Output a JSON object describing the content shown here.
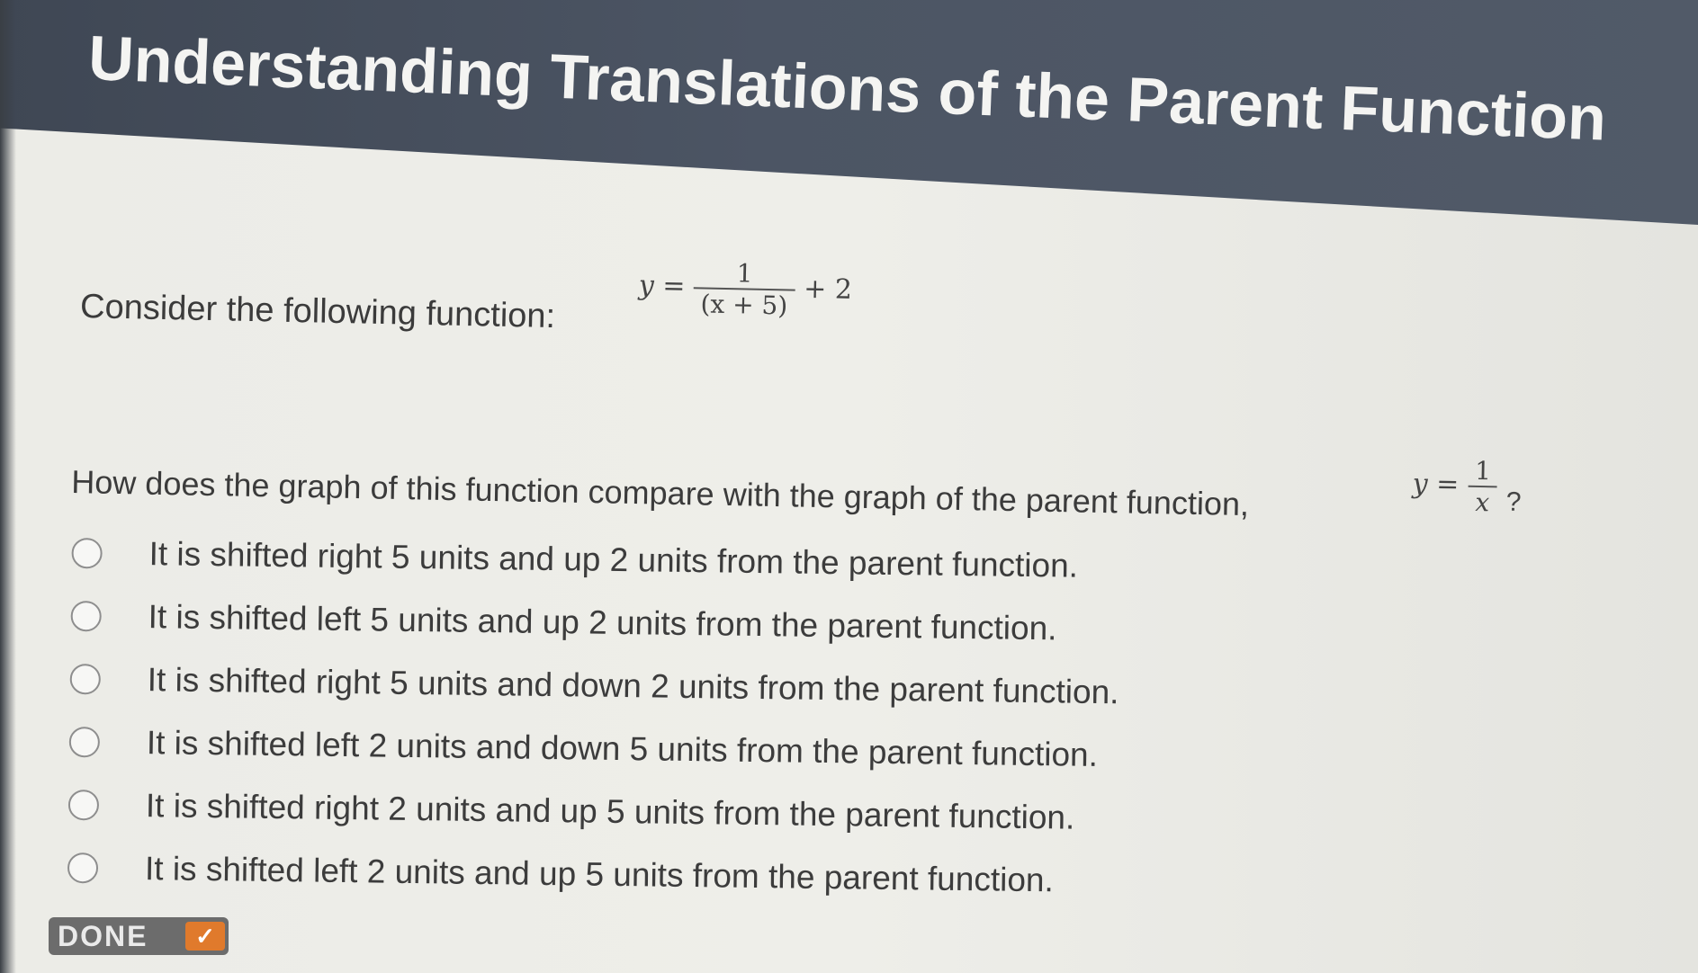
{
  "header": {
    "title": "Understanding Translations of the Parent Function"
  },
  "prompt": {
    "text": "Consider the following function:",
    "equation": {
      "lhs": "y",
      "eq": "=",
      "numerator": "1",
      "denominator": "(x + 5)",
      "tail": "+ 2"
    }
  },
  "question": {
    "text": "How does the graph of this function compare with the graph of the parent function,",
    "parent": {
      "lhs": "y",
      "eq": "=",
      "numerator": "1",
      "denominator": "x"
    },
    "end": "?"
  },
  "options": [
    "It is shifted right 5 units and up 2 units from the parent function.",
    "It is shifted left 5 units and up 2 units from the parent function.",
    "It is shifted right 5 units and down 2 units from the parent function.",
    "It is shifted left 2 units and down 5 units from the parent function.",
    "It is shifted right 2 units and up 5 units from the parent function.",
    "It is shifted left 2 units and up 5 units from the parent function."
  ],
  "done_button": {
    "label": "DONE",
    "icon": "checkmark-icon"
  },
  "colors": {
    "header": "#4c5564",
    "done": "#6c6c6c",
    "accent": "#e07a2c"
  }
}
